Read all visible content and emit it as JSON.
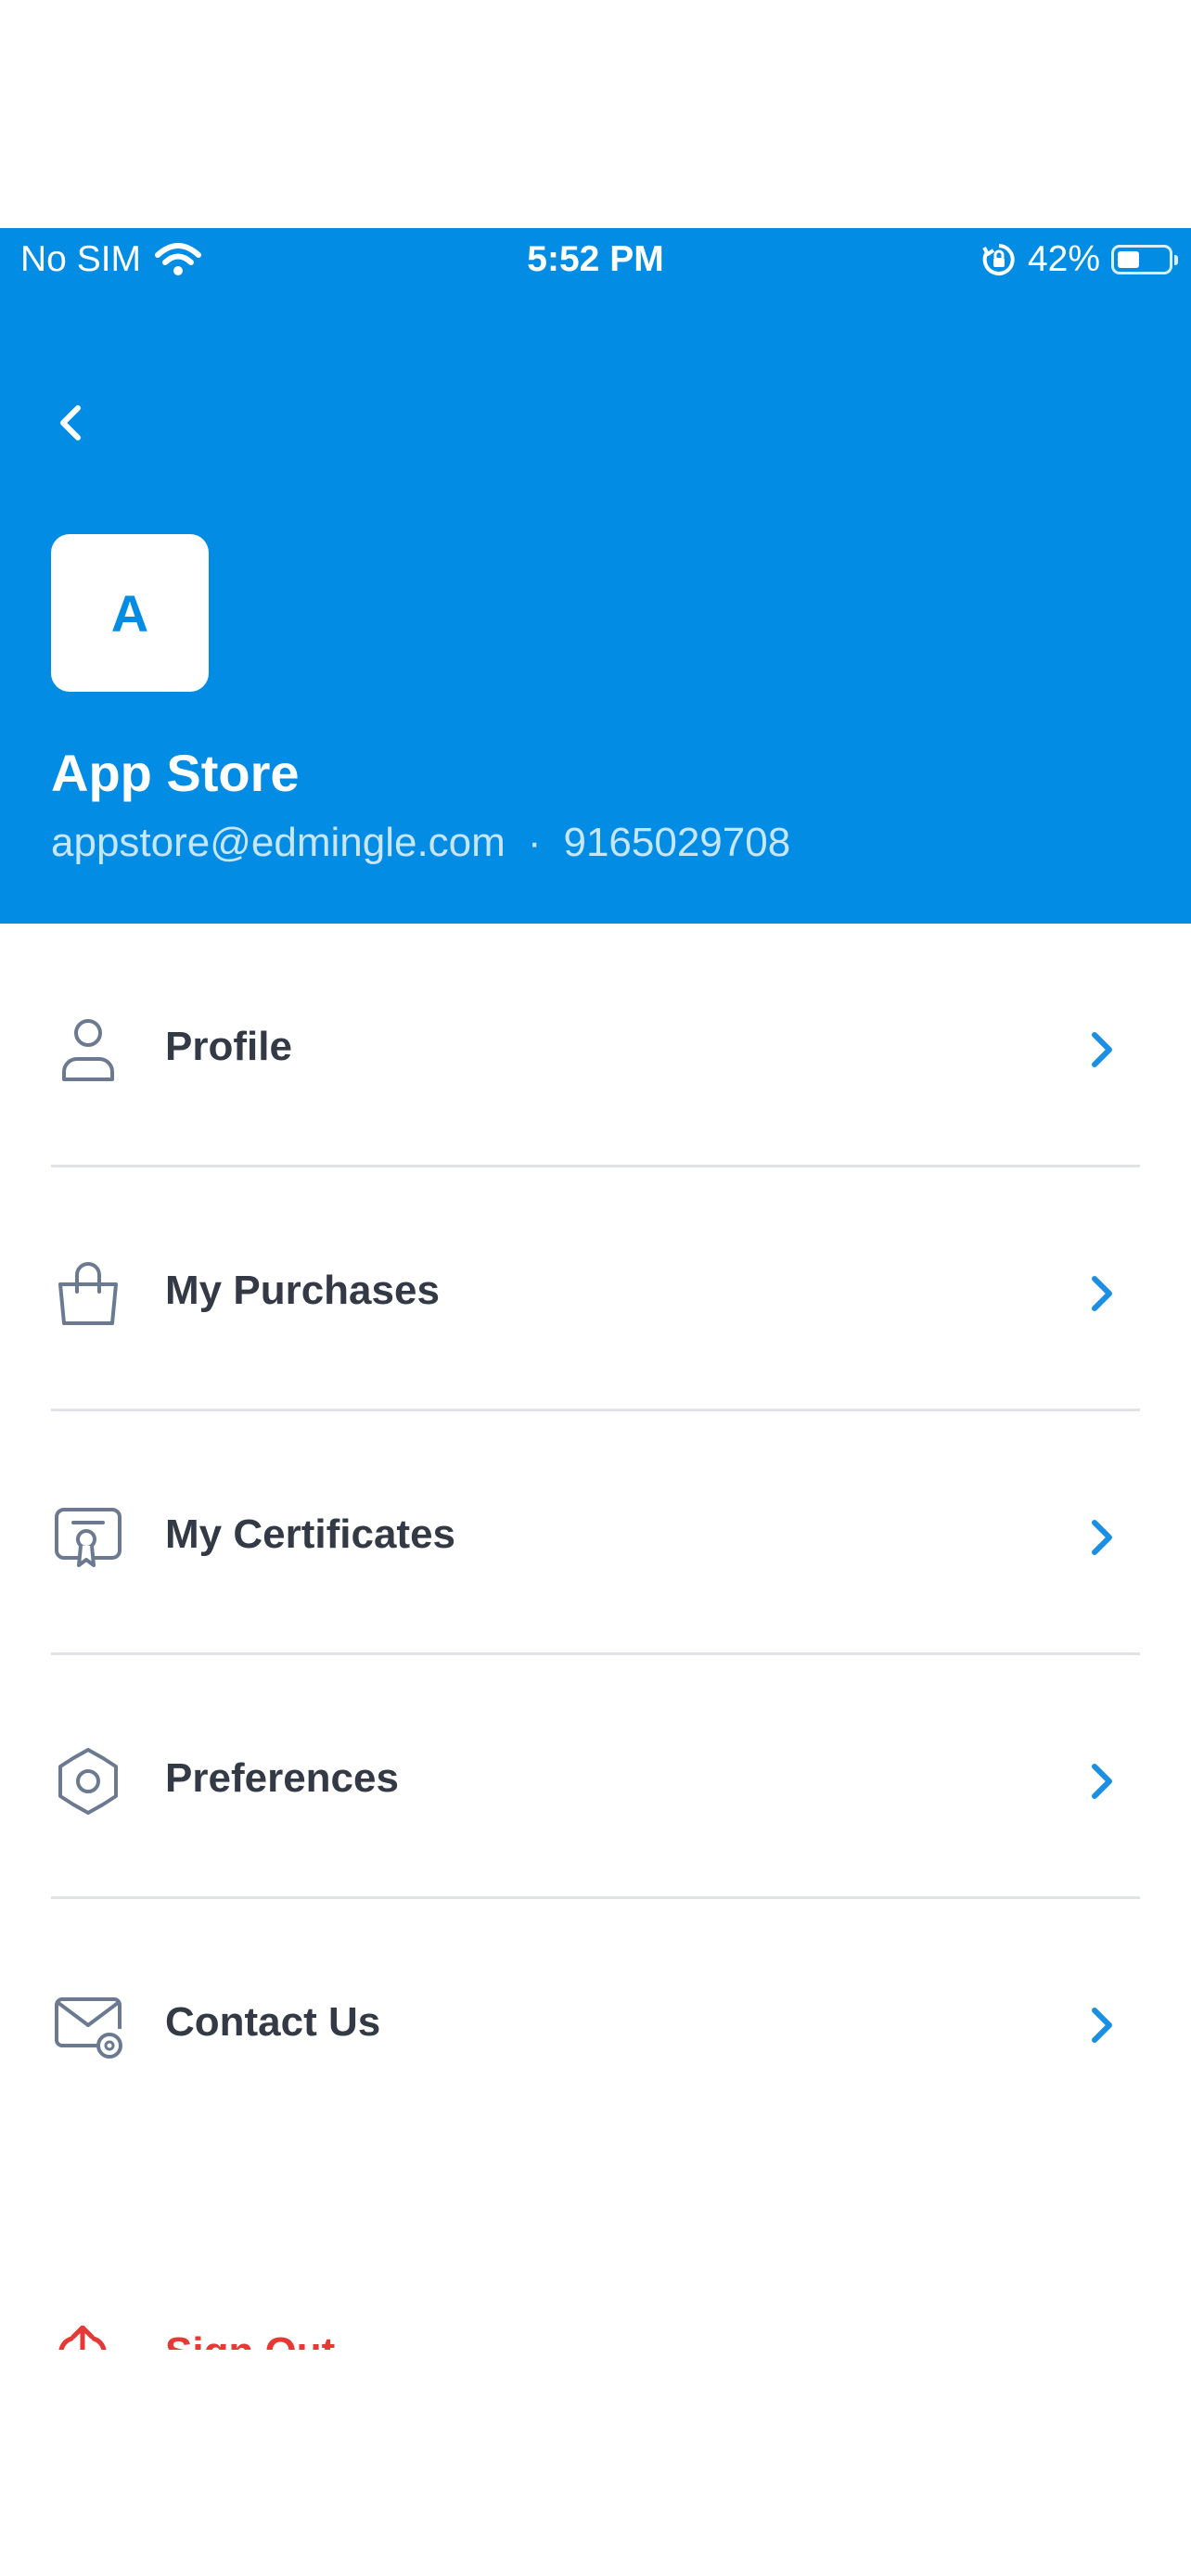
{
  "status_bar": {
    "carrier": "No SIM",
    "time": "5:52 PM",
    "battery": "42%",
    "battery_level": 0.42
  },
  "header": {
    "avatar_initial": "A",
    "name": "App Store",
    "email": "appstore@edmingle.com",
    "separator": "·",
    "phone": "9165029708",
    "background": "#038ce3"
  },
  "menu": {
    "items": [
      {
        "label": "Profile",
        "icon": "user-icon"
      },
      {
        "label": "My Purchases",
        "icon": "shopping-bag-icon"
      },
      {
        "label": "My Certificates",
        "icon": "certificate-icon"
      },
      {
        "label": "Preferences",
        "icon": "gear-icon"
      },
      {
        "label": "Contact Us",
        "icon": "mail-icon"
      }
    ],
    "chevron_color": "#1a8fe3"
  },
  "signout": {
    "label": "Sign Out",
    "icon": "sign-out-icon",
    "color": "#e53935"
  }
}
